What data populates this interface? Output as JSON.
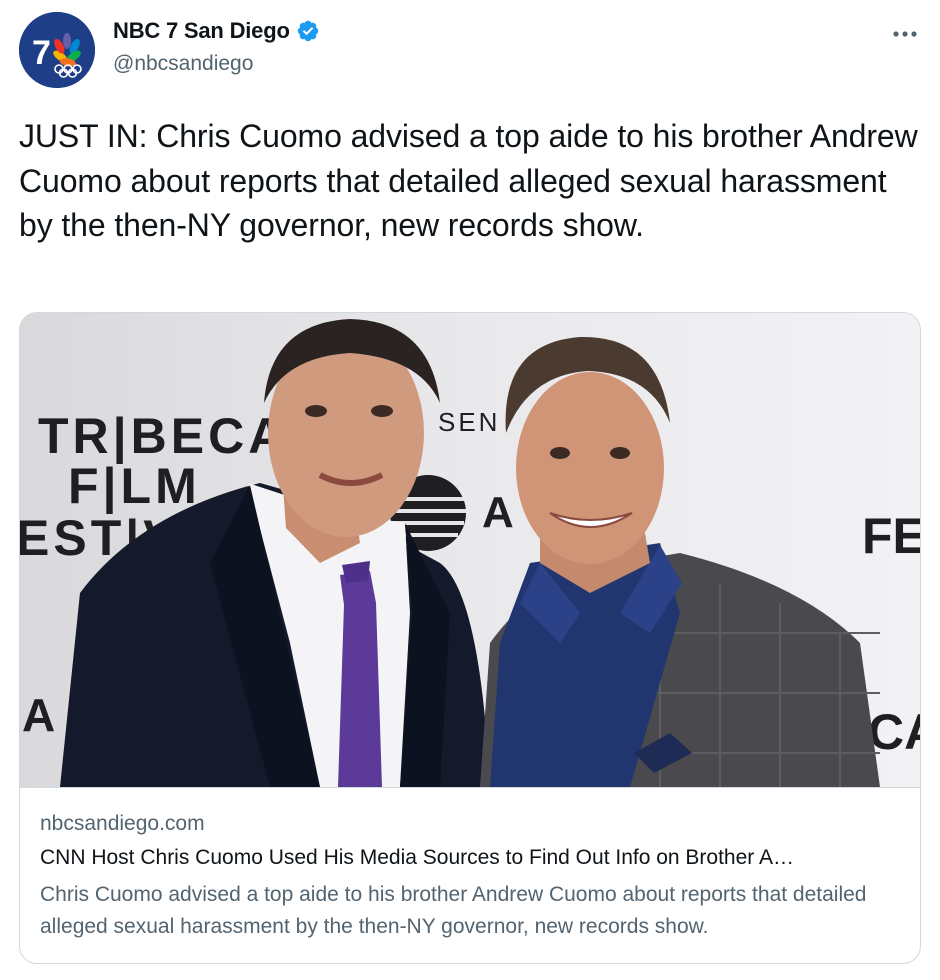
{
  "account": {
    "display_name": "NBC 7 San Diego",
    "handle": "@nbcsandiego",
    "verified": true,
    "avatar_text": "7",
    "avatar_color": "#1e3f87"
  },
  "more_icon": "more-horizontal-icon",
  "tweet": {
    "text": "JUST IN: Chris Cuomo advised a top aide to his brother Andrew Cuomo about reports that detailed alleged sexual harassment by the then-NY governor, new records show."
  },
  "card": {
    "image_alt": "Andrew Cuomo and Chris Cuomo at Tribeca Film Festival",
    "backdrop_text": {
      "line1": "TR|BECA",
      "line2": "F|LM",
      "line3": "EST|VA",
      "sen": "SEN",
      "fe": "FE",
      "ca": "CA",
      "a_left": "A",
      "a_mid": "A"
    },
    "domain": "nbcsandiego.com",
    "title": "CNN Host Chris Cuomo Used His Media Sources to Find Out Info on Brother A…",
    "description": "Chris Cuomo advised a top aide to his brother Andrew Cuomo about reports that detailed alleged sexual harassment by the then-NY governor, new records show."
  },
  "colors": {
    "text_primary": "#0f1419",
    "text_secondary": "#536471",
    "verified_blue": "#1d9bf0",
    "border": "#cfd9de"
  }
}
